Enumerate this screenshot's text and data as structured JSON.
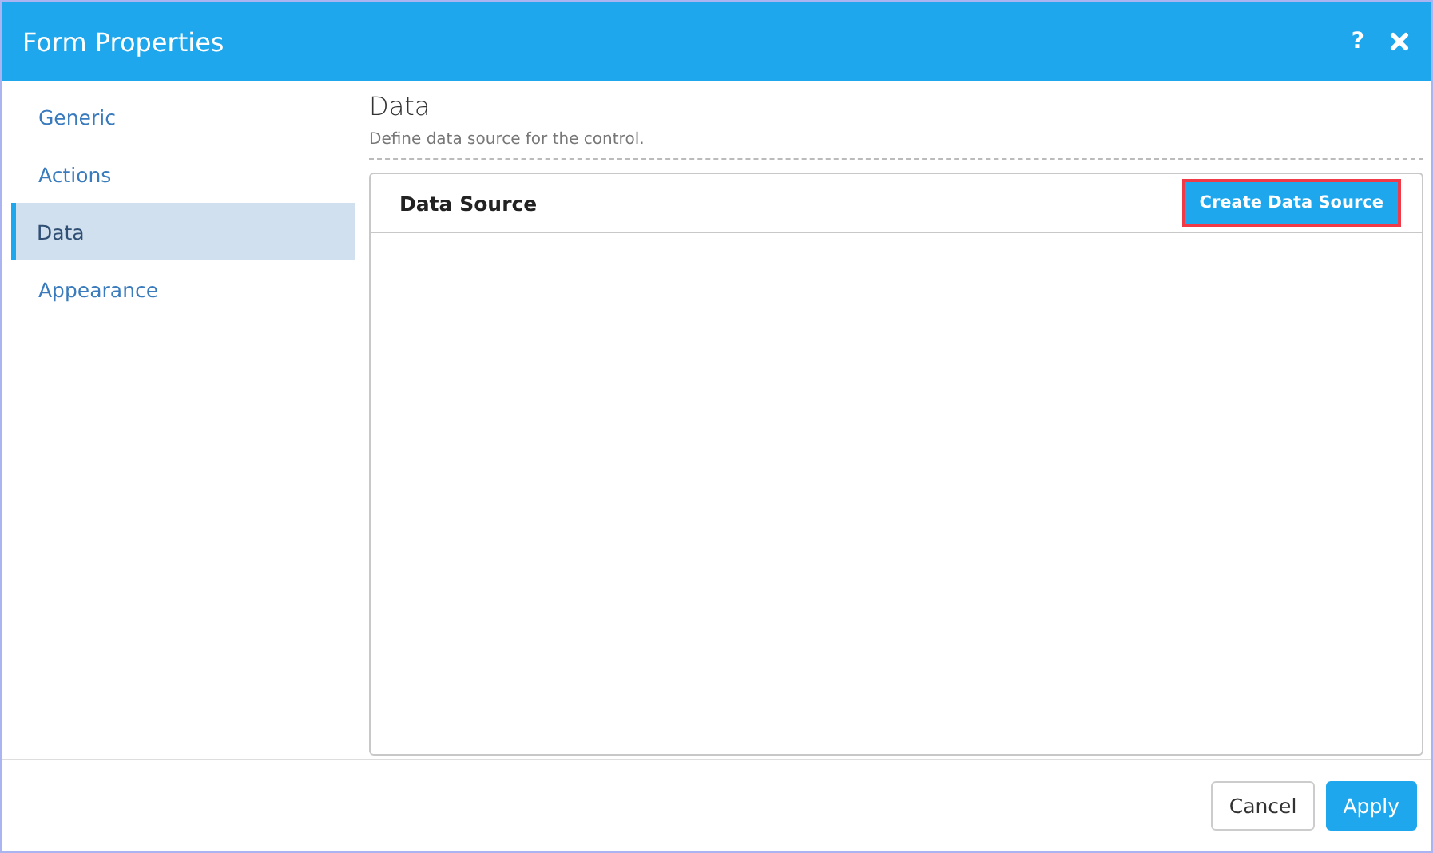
{
  "window": {
    "title": "Form Properties",
    "help": "?"
  },
  "sidebar": {
    "items": [
      {
        "label": "Generic",
        "selected": false
      },
      {
        "label": "Actions",
        "selected": false
      },
      {
        "label": "Data",
        "selected": true
      },
      {
        "label": "Appearance",
        "selected": false
      }
    ]
  },
  "section": {
    "title": "Data",
    "description": "Define data source for the control."
  },
  "panel": {
    "title": "Data Source",
    "button": {
      "label": "Create Data Source",
      "highlighted": true
    }
  },
  "footer": {
    "buttons": [
      {
        "label": "Cancel",
        "kind": "secondary"
      },
      {
        "label": "Apply",
        "kind": "primary"
      }
    ]
  }
}
